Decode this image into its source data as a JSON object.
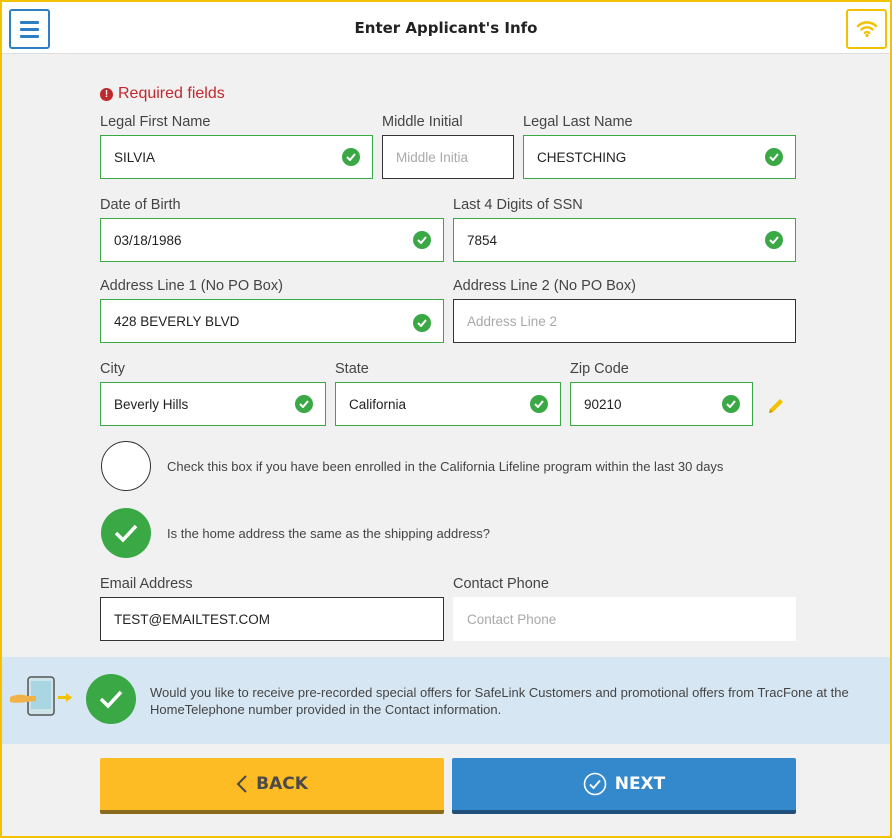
{
  "header": {
    "title": "Enter Applicant's Info"
  },
  "form": {
    "required_note": "Required fields",
    "first_name": {
      "label": "Legal First Name",
      "value": "SILVIA"
    },
    "middle_initial": {
      "label": "Middle Initial",
      "placeholder": "Middle Initial",
      "value": ""
    },
    "last_name": {
      "label": "Legal Last Name",
      "value": "CHESTCHING"
    },
    "dob": {
      "label": "Date of Birth",
      "value": "03/18/1986"
    },
    "ssn4": {
      "label": "Last 4 Digits of SSN",
      "value": "7854"
    },
    "address1": {
      "label": "Address Line 1 (No PO Box)",
      "value": "428 BEVERLY BLVD"
    },
    "address2": {
      "label": "Address Line 2 (No PO Box)",
      "placeholder": "Address Line 2",
      "value": ""
    },
    "city": {
      "label": "City",
      "value": "Beverly Hills"
    },
    "state": {
      "label": "State",
      "value": "California"
    },
    "zip": {
      "label": "Zip Code",
      "value": "90210"
    },
    "lifeline_text": "Check this box if you have been enrolled in the California Lifeline program within the last 30 days",
    "lifeline_checked": false,
    "shipping_text": "Is the home address the same as the shipping address?",
    "shipping_checked": true,
    "email": {
      "label": "Email Address",
      "value": "TEST@EMAILTEST.COM"
    },
    "phone": {
      "label": "Contact Phone",
      "placeholder": "Contact Phone",
      "value": ""
    }
  },
  "promo": {
    "text": "Would you like to receive pre-recorded special offers for SafeLink Customers and promotional offers from TracFone at the HomeTelephone number provided in the Contact information.",
    "checked": true
  },
  "buttons": {
    "back": "BACK",
    "next": "NEXT"
  },
  "colors": {
    "valid_green": "#3aa845",
    "required_red": "#c0282e",
    "accent_yellow": "#fdbc23",
    "accent_blue": "#3489cd",
    "frame_yellow": "#f2c200"
  },
  "icons": {
    "menu": "hamburger-menu-icon",
    "wifi": "wifi-icon",
    "required": "exclamation-circle-icon",
    "valid": "check-circle-icon",
    "edit": "pencil-icon",
    "promo": "tablet-hand-icon",
    "back": "chevron-left-icon",
    "next": "check-circle-outline-icon"
  }
}
